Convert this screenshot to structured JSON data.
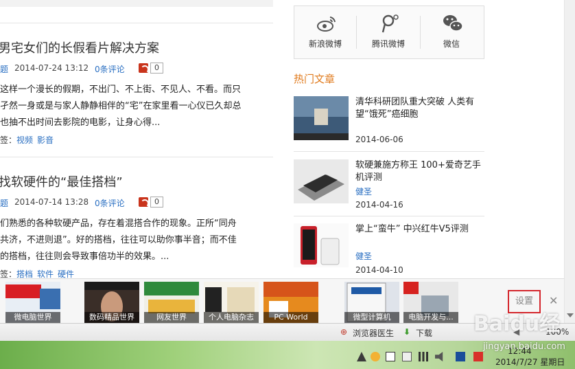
{
  "articles": [
    {
      "title": "男宅女们的长假看片解决方案",
      "category_fragment": "题",
      "date": "2014-07-24 13:12",
      "comments": "0条评论",
      "count": "0",
      "body": "这样一个漫长的假期，不出门、不上街、不见人、不看​。而只孑然一身或是与家人静静相伴的“宅”在家里看一​心仪已久却总也抽不出时间去影院的电影，让身心得...",
      "tags_prefix": "签：",
      "tags": [
        "视频",
        "影音"
      ]
    },
    {
      "title": "找软硬件的“最佳搭档”",
      "category_fragment": "题",
      "date": "2014-07-14 13:28",
      "comments": "0条评论",
      "count": "0",
      "body": "们熟悉的各种软硬产品，存在着混搭合作的现象。正所​“同舟共济，不进则退”。好的搭档，往往可以助你事半​音；而不佳的搭档，往往则会导致事倍功半的效果。...",
      "tags_prefix": "签：",
      "tags": [
        "搭档",
        "软件",
        "硬件"
      ]
    }
  ],
  "share": [
    {
      "label": "新浪微博",
      "icon": "weibo-icon"
    },
    {
      "label": "腾讯微博",
      "icon": "tencent-weibo-icon"
    },
    {
      "label": "微信",
      "icon": "wechat-icon"
    }
  ],
  "hot": {
    "title": "热门文章",
    "items": [
      {
        "title": "清华科研团队重大突破 人类有望“饿死”癌细胞",
        "author": "",
        "date": "2014-06-06"
      },
      {
        "title": "软硬兼施方称王 100+爱奇艺手机评测",
        "author": "健圣",
        "date": "2014-04-16"
      },
      {
        "title": "掌上“蛮牛” 中兴红牛V5评测",
        "author": "健圣",
        "date": "2014-04-10"
      }
    ]
  },
  "magazines": [
    {
      "caption": "微电脑世界",
      "cover_text": "PC WORLD"
    },
    {
      "caption": "数码精品世界",
      "cover_text": "数码精品世界"
    },
    {
      "caption": "网友世界",
      "cover_text": "网友世界"
    },
    {
      "caption": "个人电脑杂志",
      "cover_text": "PC THE NEXT 25"
    },
    {
      "caption": "PC World",
      "cover_text": "PCWorld"
    },
    {
      "caption": "微型计算机",
      "cover_text": "微型计算机"
    },
    {
      "caption": "电脑开发与...",
      "cover_text": "电脑"
    }
  ],
  "mag_settings": "设置",
  "mag_close": "✕",
  "statusbar": {
    "doctor": "浏览器医生",
    "download": "下载",
    "zoom": "100%"
  },
  "clock": {
    "time": "12:44",
    "date": "2014/7/27 星期日"
  },
  "watermark": {
    "logo": "Baidu经验",
    "url": "jingyan.baidu.com"
  },
  "colors": {
    "accent_link": "#2a6fc2",
    "hot_title": "#e07a1c",
    "settings_border": "#d4262c"
  }
}
